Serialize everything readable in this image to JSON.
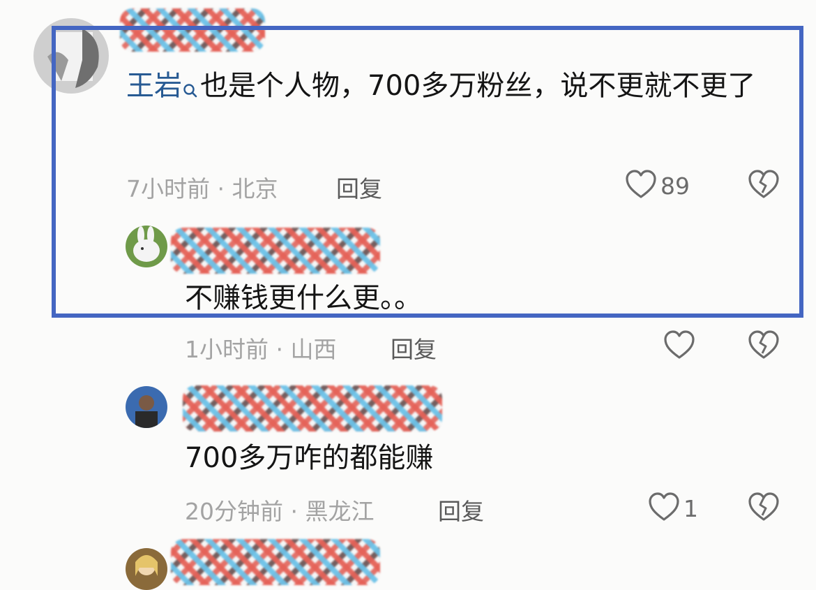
{
  "highlight_color": "#4466c2",
  "comments": [
    {
      "mention": "王岩",
      "text": "也是个人物，700多万粉丝，说不更就不更了",
      "meta": "7小时前 · 北京",
      "reply_label": "回复",
      "likes": "89"
    },
    {
      "text": "不赚钱更什么更。。",
      "meta": "1小时前 · 山西",
      "reply_label": "回复",
      "likes": ""
    },
    {
      "text": "700多万咋的都能赚",
      "meta": "20分钟前 · 黑龙江",
      "reply_label": "回复",
      "likes": "1"
    }
  ]
}
